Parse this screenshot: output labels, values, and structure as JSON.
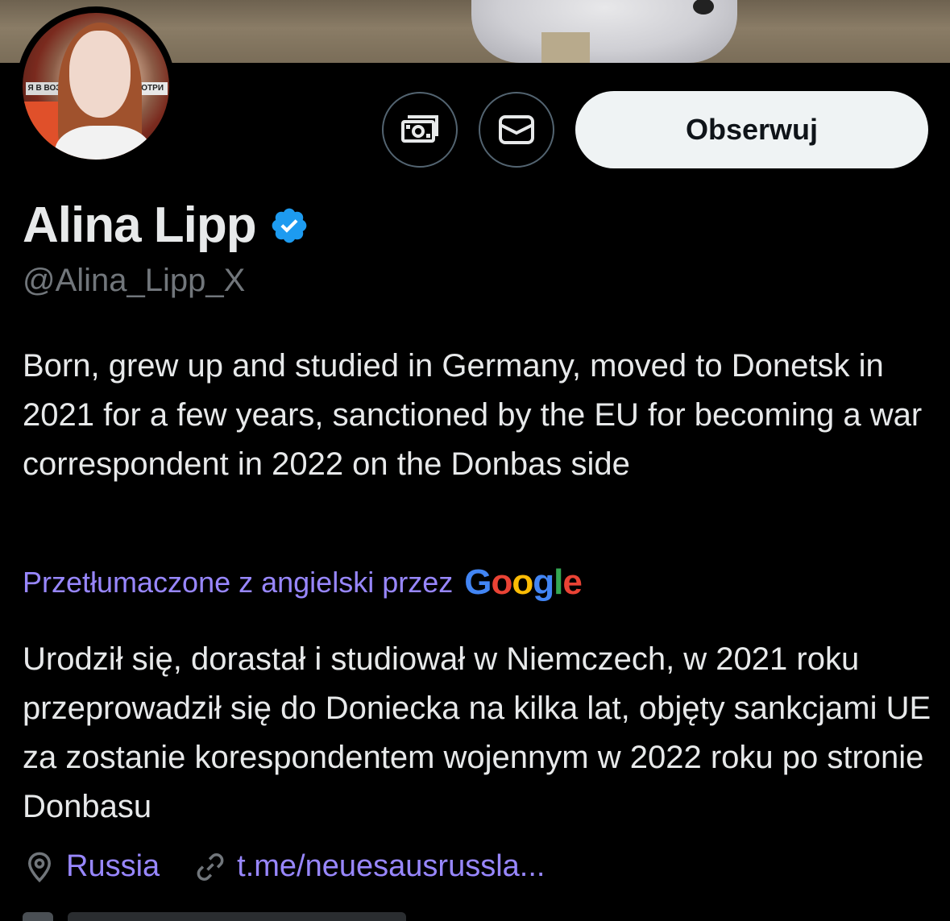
{
  "header": {
    "avatar_sign_left": "Я В ВОЗ",
    "avatar_sign_right": "МОТРИ"
  },
  "actions": {
    "tip_icon": "money-icon",
    "message_icon": "mail-icon",
    "follow_label": "Obserwuj"
  },
  "profile": {
    "name": "Alina Lipp",
    "verified_icon": "verified-badge-icon",
    "handle": "@Alina_Lipp_X",
    "bio": "Born, grew up and studied in Germany, moved to Donetsk in 2021 for a few years, sanctioned by the EU for becoming a war correspondent in 2022 on the Donbas side",
    "translated_by_label": "Przetłumaczone z angielski przez",
    "translator_brand": "Google",
    "translation": "Urodził się, dorastał i studiował w Niemczech, w 2021 roku przeprowadził się do Doniecka na kilka lat, objęty sankcjami UE za zostanie korespondentem wojennym w 2022 roku po stronie Donbasu",
    "location": "Russia",
    "website": "t.me/neuesausrussla..."
  },
  "colors": {
    "background": "#000000",
    "text": "#e7e9ea",
    "secondary": "#71767b",
    "accent": "#9887ff",
    "verified": "#1d9bf0",
    "button": "#eff3f4"
  }
}
